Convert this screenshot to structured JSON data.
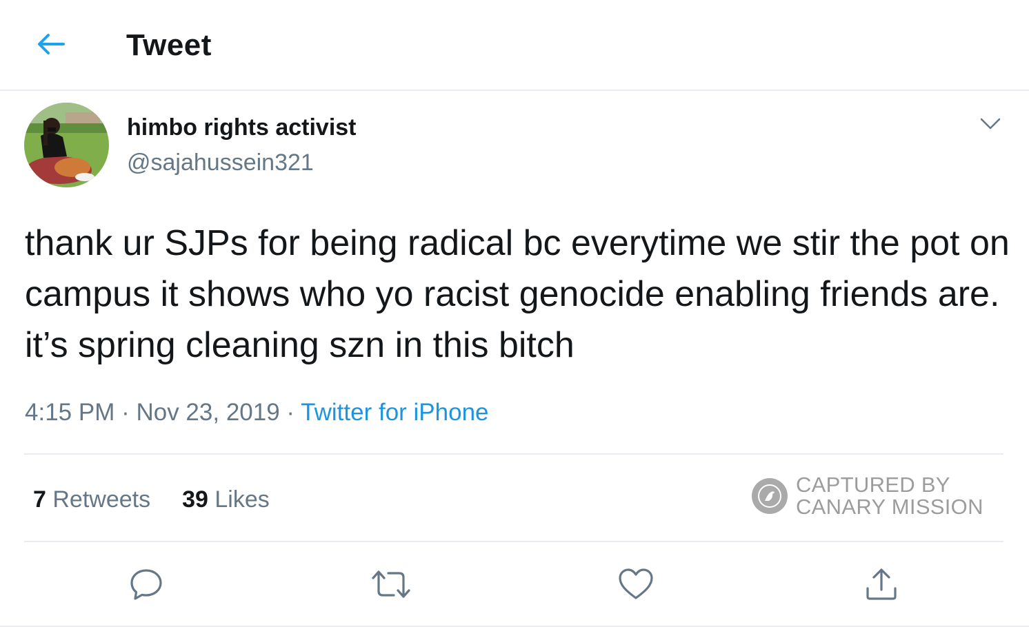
{
  "header": {
    "title": "Tweet",
    "back_icon": "arrow-left-icon",
    "accent_color": "#1da1f2"
  },
  "author": {
    "display_name": "himbo rights activist",
    "handle": "@sajahussein321"
  },
  "tweet": {
    "text": "thank ur SJPs for being radical bc everytime we stir the pot on campus it shows who yo racist genocide enabling friends are. it’s spring cleaning szn in this bitch",
    "time": "4:15 PM",
    "separator": " · ",
    "date": "Nov 23, 2019",
    "source": "Twitter for iPhone"
  },
  "stats": {
    "retweets_count": "7",
    "retweets_label": " Retweets",
    "likes_count": "39",
    "likes_label": " Likes"
  },
  "watermark": {
    "line1": "CAPTURED BY",
    "line2": "CANARY MISSION"
  },
  "actions": [
    "reply-icon",
    "retweet-icon",
    "like-icon",
    "share-icon"
  ],
  "colors": {
    "text": "#14171a",
    "secondary": "#657786",
    "link": "#1b95e0",
    "border": "#e6ecf0"
  }
}
